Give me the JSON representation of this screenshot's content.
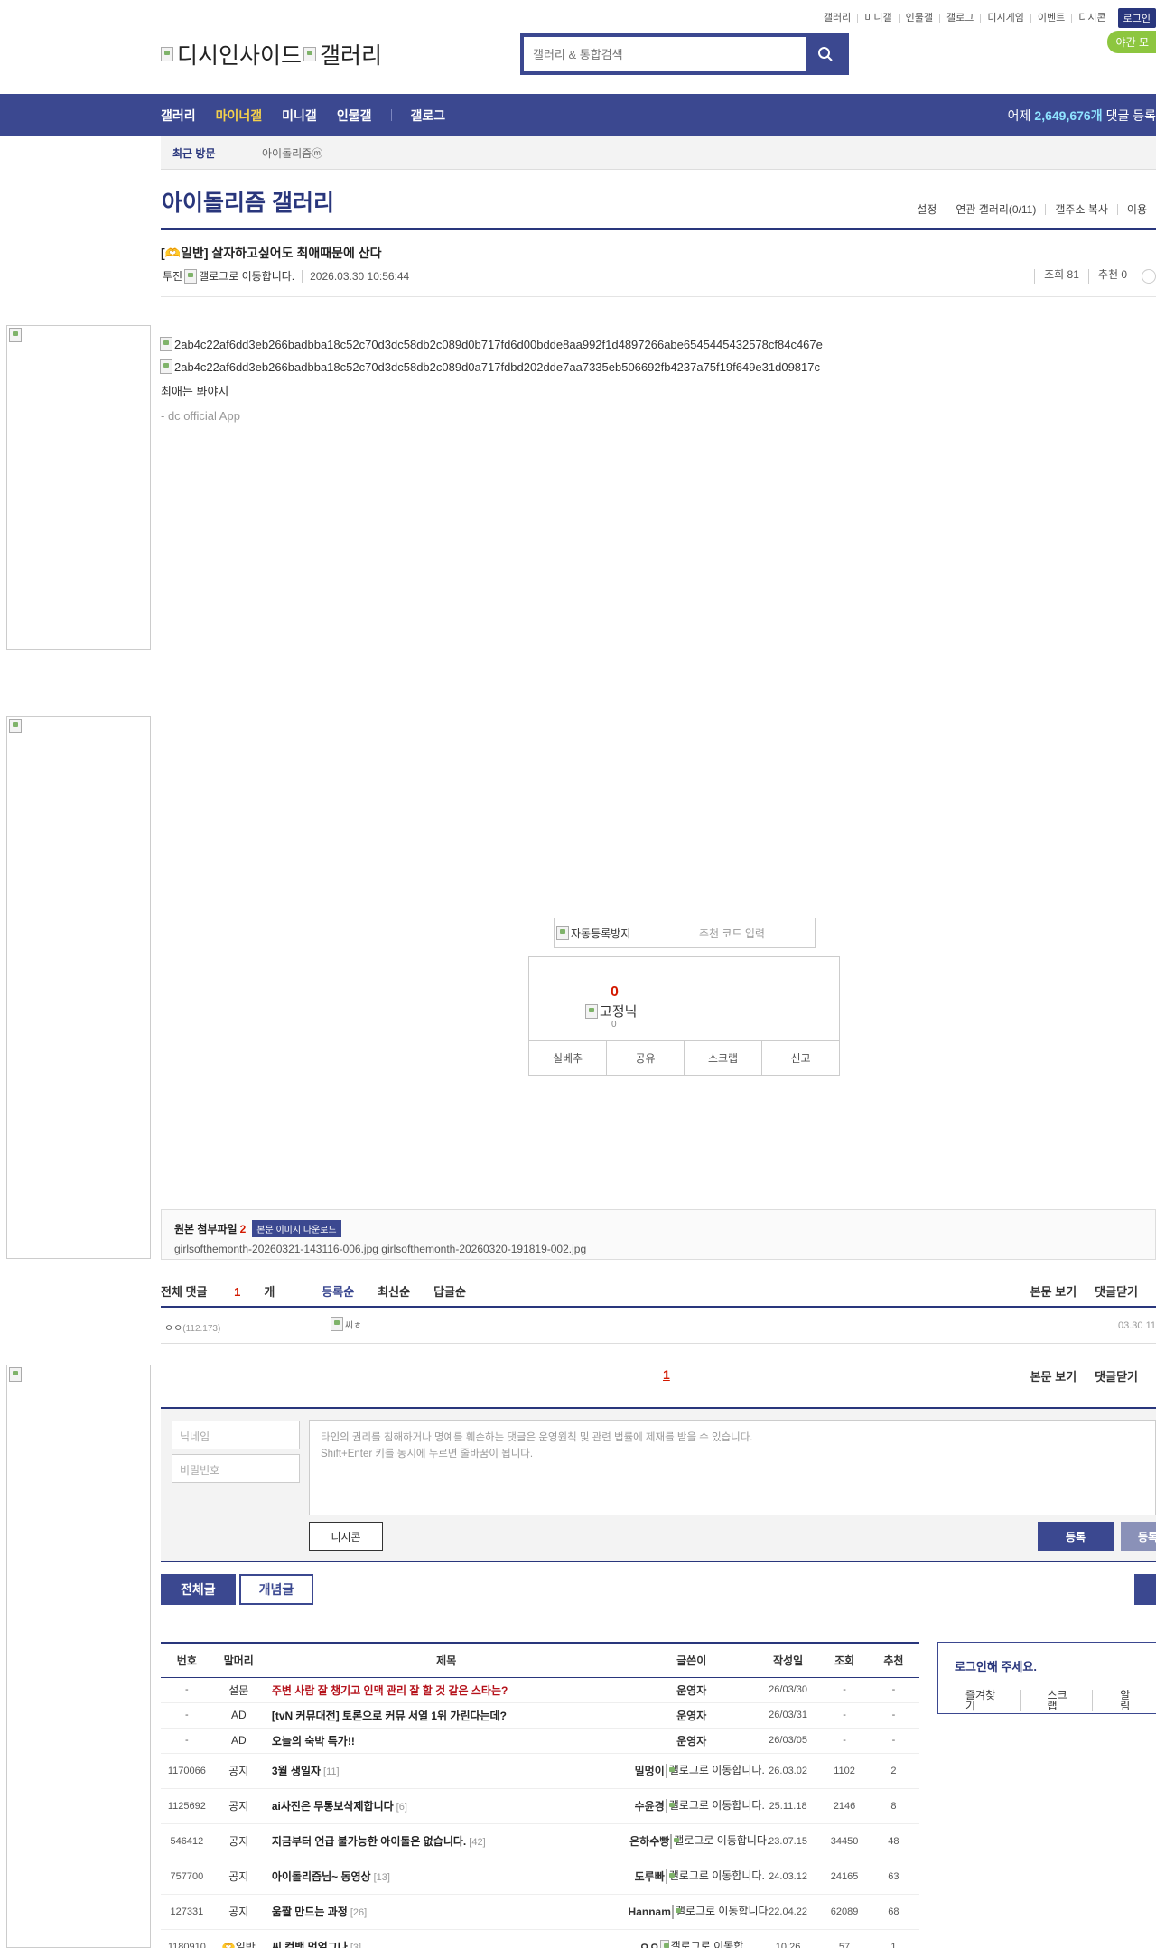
{
  "util": {
    "links": [
      "갤러리",
      "미니갤",
      "인물갤",
      "갤로그",
      "디시게임",
      "이벤트",
      "디시콘"
    ],
    "login": "로그인",
    "night_mode": "야간 모"
  },
  "header": {
    "logo_alt_1": "디시인사이드",
    "logo_alt_2": "갤러리",
    "search_placeholder": "갤러리 & 통합검색"
  },
  "nav": {
    "items": [
      "갤러리",
      "마이너갤",
      "미니갤",
      "인물갤",
      "갤로그"
    ],
    "active": "마이너갤",
    "stat_prefix": "어제",
    "stat_value": "2,649,676개",
    "stat_suffix": "댓글 등록"
  },
  "visit": {
    "title": "최근 방문",
    "gallery": "아이돌리즘ⓜ"
  },
  "gallery": {
    "title": "아이돌리즘 갤러리",
    "tools": [
      "설정",
      "연관 갤러리(0/11)",
      "갤주소 복사",
      "이용"
    ]
  },
  "post": {
    "title": "[🫶일반] 살자하고싶어도 최애때문에 산다",
    "writer": "투진",
    "gallog_alt": "갤로그로 이동합니다.",
    "date": "2026.03.30 10:56:44",
    "views": "조회 81",
    "recommend": "추천 0",
    "image_alt_1": "2ab4c22af6dd3eb266badbba18c52c70d3dc58db2c089d0b717fd6d00bdde8aa992f1d4897266abe6545445432578cf84c467e",
    "image_alt_2": "2ab4c22af6dd3eb266badbba18c52c70d3dc58db2c089d0a717fdbd202dde7aa7335eb506692fb4237a75f19f649e31d09817c",
    "body_text": "최애는 봐야지",
    "app_sign": "- dc official App"
  },
  "captcha": {
    "alt": "자동등록방지",
    "placeholder": "추천 코드 입력"
  },
  "recommend_box": {
    "count": "0",
    "fix_alt": "고정닉",
    "fix_count": "0",
    "buttons": [
      "실베추",
      "공유",
      "스크랩",
      "신고"
    ]
  },
  "files": {
    "label": "원본 첨부파일",
    "count": "2",
    "download": "본문 이미지 다운로드",
    "names": "girlsofthemonth-20260321-143116-006.jpg  girlsofthemonth-20260320-191819-002.jpg"
  },
  "comments": {
    "total_label": "전체 댓글",
    "total_count": "1",
    "total_unit": "개",
    "sorts": [
      "등록순",
      "최신순",
      "답글순"
    ],
    "actions": [
      "본문 보기",
      "댓글닫기"
    ],
    "row": {
      "writer": "ㅇㅇ",
      "ip": "(112.173)",
      "dccon_alt": "씨ㅎ",
      "time": "03.30 11"
    },
    "page": "1"
  },
  "write": {
    "nick_placeholder": "닉네임",
    "pw_placeholder": "비밀번호",
    "notice_1": "타인의 권리를 침해하거나 명예를 훼손하는 댓글은 운영원칙 및 관련 법률에 제재를 받을 수 있습니다.",
    "notice_2": "Shift+Enter 키를 동시에 누르면 줄바꿈이 됩니다.",
    "dccon": "디시콘",
    "submit": "등록",
    "submit2": "등록"
  },
  "tabs": [
    "전체글",
    "개념글"
  ],
  "list": {
    "headers": [
      "번호",
      "말머리",
      "제목",
      "글쓴이",
      "작성일",
      "조회",
      "추천"
    ],
    "rows": [
      {
        "no": "-",
        "head": "설문",
        "title": "주변 사람 잘 챙기고 인맥 관리 잘 할 것 같은 스타는?",
        "rc": "",
        "writer": "운영자",
        "gallog": "",
        "date": "26/03/30",
        "views": "-",
        "rec": "-",
        "hot": true
      },
      {
        "no": "-",
        "head": "AD",
        "title": "[tvN 커뮤대전] 토론으로 커뮤 서열 1위 가린다는데?",
        "rc": "",
        "writer": "운영자",
        "gallog": "",
        "date": "26/03/31",
        "views": "-",
        "rec": "-",
        "hot": false
      },
      {
        "no": "-",
        "head": "AD",
        "title": "오늘의 숙박 특가!!",
        "rc": "",
        "writer": "운영자",
        "gallog": "",
        "date": "26/03/05",
        "views": "-",
        "rec": "-",
        "hot": false
      },
      {
        "no": "1170066",
        "head": "공지",
        "title": "3월 생일자",
        "rc": "[11]",
        "writer": "밀멍이",
        "gallog": "갤로그로 이동합니다.",
        "date": "26.03.02",
        "views": "1102",
        "rec": "2",
        "hot": false
      },
      {
        "no": "1125692",
        "head": "공지",
        "title": "ai사진은 무통보삭제합니다",
        "rc": "[6]",
        "writer": "수윤경",
        "gallog": "갤로그로 이동합니다.",
        "date": "25.11.18",
        "views": "2146",
        "rec": "8",
        "hot": false
      },
      {
        "no": "546412",
        "head": "공지",
        "title": "지금부터 언급 불가능한 아이돌은 없습니다.",
        "rc": "[42]",
        "writer": "은하수빵",
        "gallog": "갤로그로 이동합니다.",
        "date": "23.07.15",
        "views": "34450",
        "rec": "48",
        "hot": false
      },
      {
        "no": "757700",
        "head": "공지",
        "title": "아이돌리즘님~ 동영상",
        "rc": "[13]",
        "writer": "도루빠",
        "gallog": "갤로그로 이동합니다.",
        "date": "24.03.12",
        "views": "24165",
        "rec": "63",
        "hot": false
      },
      {
        "no": "127331",
        "head": "공지",
        "title": "움짤 만드는 과정",
        "rc": "[26]",
        "writer": "Hannam",
        "gallog": "갤로그로 이동합니다.",
        "date": "22.04.22",
        "views": "62089",
        "rec": "68",
        "hot": false
      },
      {
        "no": "1180910",
        "head": "🫶일반",
        "title": "씨 컴백 멈얼그나",
        "rc": "[3]",
        "writer": "ㅇㅇ",
        "gallog": "갤로그로 이동합",
        "date": "10:26",
        "views": "57",
        "rec": "1",
        "hot": false
      }
    ]
  },
  "loginbox": {
    "title": "로그인해 주세요.",
    "links": [
      "즐겨찾기",
      "스크랩",
      "알림"
    ]
  },
  "colors": {
    "brand": "#3b4890",
    "accent": "#d31900",
    "active_nav": "#f5d14b",
    "night": "#8dc63f"
  }
}
